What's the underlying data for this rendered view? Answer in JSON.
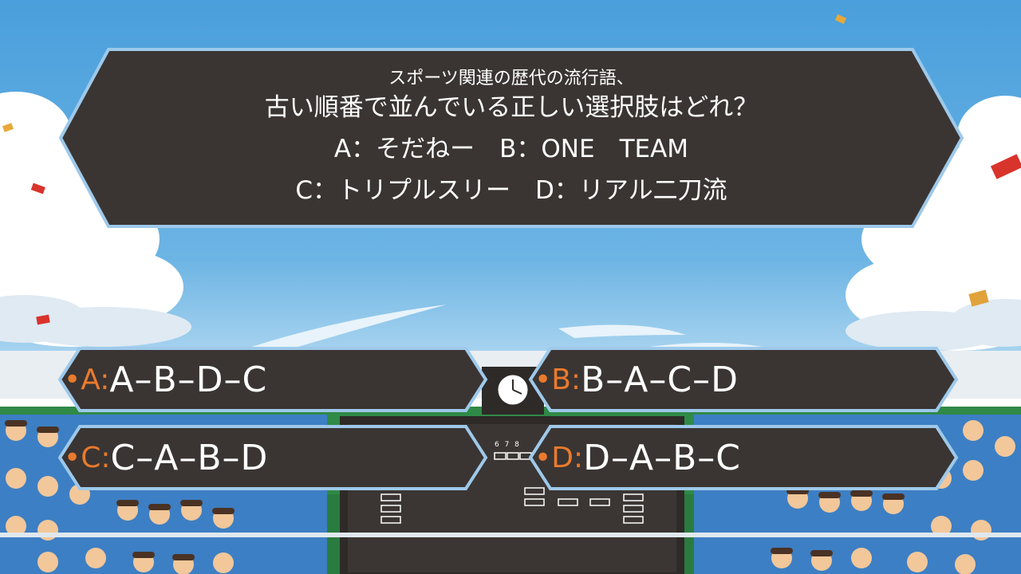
{
  "question": {
    "line1": "スポーツ関連の歴代の流行語、",
    "line2": "古い順番で並んでいる正しい選択肢はどれ？",
    "line3": "A：そだねー　B：ONE　TEAM",
    "line4": "C：トリプルスリー　D：リアル二刀流"
  },
  "answers": [
    {
      "letter": "•A:",
      "value": "A–B–D–C"
    },
    {
      "letter": "•B:",
      "value": "B–A–C–D"
    },
    {
      "letter": "•C:",
      "value": "C–A–B–D"
    },
    {
      "letter": "•D:",
      "value": "D–A–B–C"
    }
  ],
  "scoreboard": {
    "numbers": "6 7 8"
  },
  "colors": {
    "panel_fill": "#3a3533",
    "panel_border": "#9ec9ea",
    "answer_letter": "#ea7a2c",
    "text": "#ffffff",
    "sky_top": "#4a9fdc"
  }
}
